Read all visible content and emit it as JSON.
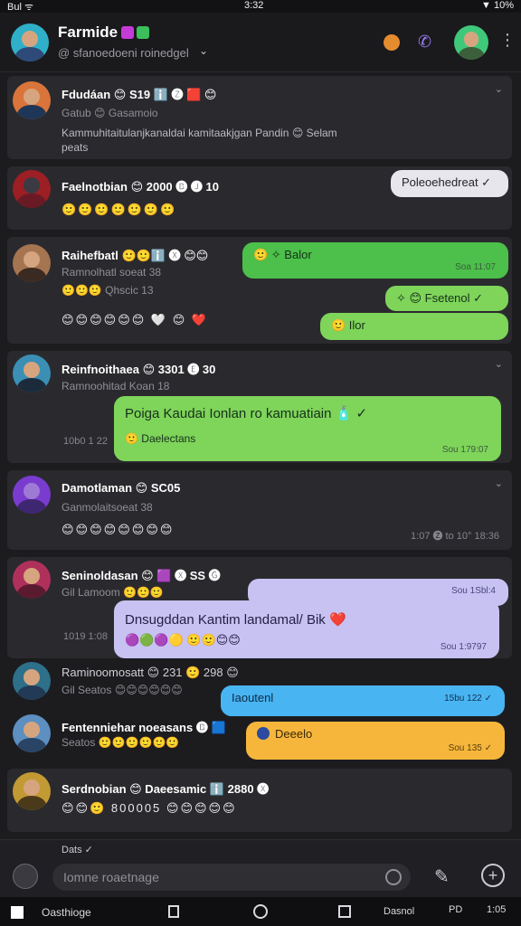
{
  "status_bar": {
    "left": "Bul ᯤ",
    "center": "3:32",
    "right": "▼ 10%"
  },
  "header": {
    "title": "Farmide",
    "subtitle": "@ sfanoedoeni roinedgel",
    "call_icon": "phone-icon",
    "menu_icon": "kebab-menu-icon"
  },
  "conversations": [
    {
      "name": "Fdudáan",
      "name_emojis": "😊 S19 ℹ️ 🅩 🟥 😊",
      "meta": "Gatub 😊 Gasamoio",
      "preview": "Kammuhitaitulanjkanaldai kamitaakjgan Pandin 😊 Selam",
      "preview2": "peats"
    },
    {
      "name": "Faelnotbian",
      "name_emojis": "😊 2000 🅑 🅙 10",
      "emoji_row": "🙂🙂🙂🙂🙂🙂🙂",
      "bubble_text": "Poleoehedreat ✓"
    },
    {
      "name": "Raihefbatl",
      "name_emojis": "🙂🙂ℹ️ 🅧 😊😊",
      "meta": "Ramnolhatl soeat 38",
      "meta2": "🙂🙂🙂 Qhscic 13",
      "emoji_row": "😊😊😊😊😊😊 🤍 😊 ❤️",
      "bubble1": "🙂 ✧ Balor",
      "bubble1_time": "Soa 11:07",
      "bubble2": "✧ 😊 Fsetenol ✓",
      "bubble3": "🙂 Ilor"
    },
    {
      "name": "Reinfnoithaea",
      "name_emojis": "😊 3301 🅔 30",
      "meta": "Ramnoohitad Koan 18",
      "bubble_text": "Poiga Kaudai Ionlan ro kamuatiain 🧴 ✓",
      "bubble_sub": "🙂 Daelectans",
      "bubble_time": "Sou 179:07",
      "side_time": "10b0 1 22"
    },
    {
      "name": "Damotlaman",
      "name_emojis": "😊 SC05",
      "meta": "Ganmolaitsoeat 38",
      "emoji_row": "😊😊😊😊😊😊😊😊",
      "right_time": "1:07 🅩 to 10° 18:36"
    },
    {
      "name": "Seninoldasan",
      "name_emojis": "😊 🟪 🅧 SS 🅖",
      "meta": "Gil Lamoom 🙂🙂🙂",
      "bubble_time_top": "Sou 1Sbl:4",
      "bubble_text": "Dnsugddan Kantim landamal/ Bik ❤️",
      "bubble_row": "🟣🟢🟣🟡 🙂🙂😊😊",
      "bubble_time": "Sou 1:9797",
      "side_time": "1019 1:08"
    },
    {
      "name": "Raminoomosatt",
      "name_emojis": "😊 231 🙂 298 😊",
      "meta": "Gil Seatos",
      "meta_emojis": "😊😊😊😊😊😊",
      "bubble_text": "Iaoutenl",
      "bubble_time": "15bu 122 ✓"
    },
    {
      "name": "Fentenniehar noeasans",
      "name_emojis": "🅑 🟦",
      "meta": "Seatos",
      "meta_emojis": "🙂🙂🙂🙂🙂🙂",
      "bubble_text": "Deeelo",
      "bubble_time": "Sou 135 ✓"
    },
    {
      "name": "Serdnobian",
      "name_emojis": "😊 Daeesamic ℹ️ 2880 🅧",
      "emoji_row": "😊😊🙂 800005 😊😊😊😊😊"
    }
  ],
  "composer": {
    "context": "Dats ✓",
    "placeholder": "Iomne roaetnage"
  },
  "nav": {
    "left": "Oasthioge",
    "right1": "Dasnol",
    "right2": "PD",
    "right3": "1:05"
  }
}
